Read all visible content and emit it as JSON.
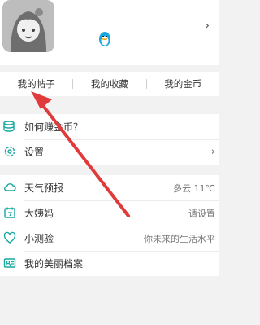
{
  "profile": {
    "avatar": "avatar",
    "qq_icon": "qq-penguin-icon",
    "chevron": "›"
  },
  "tabs": [
    {
      "label": "我的帖子"
    },
    {
      "label": "我的收藏"
    },
    {
      "label": "我的金币"
    }
  ],
  "menu": [
    {
      "icon": "coins-icon",
      "label": "如何赚金币？",
      "value": "",
      "chevron": ""
    },
    {
      "icon": "gear-icon",
      "label": "设置",
      "value": "",
      "chevron": "›"
    },
    {
      "icon": "weather-icon",
      "label": "天气预报",
      "value": "多云 11℃",
      "chevron": ""
    },
    {
      "icon": "calendar-icon",
      "label": "大姨妈",
      "value": "请设置",
      "chevron": ""
    },
    {
      "icon": "heart-test-icon",
      "label": "小测验",
      "value": "你未来的生活水平",
      "chevron": ""
    },
    {
      "icon": "profile-card-icon",
      "label": "我的美丽档案",
      "value": "",
      "chevron": ""
    }
  ],
  "colors": {
    "accent_teal": "#18a8a0",
    "annotation_red": "#e03a3a"
  }
}
